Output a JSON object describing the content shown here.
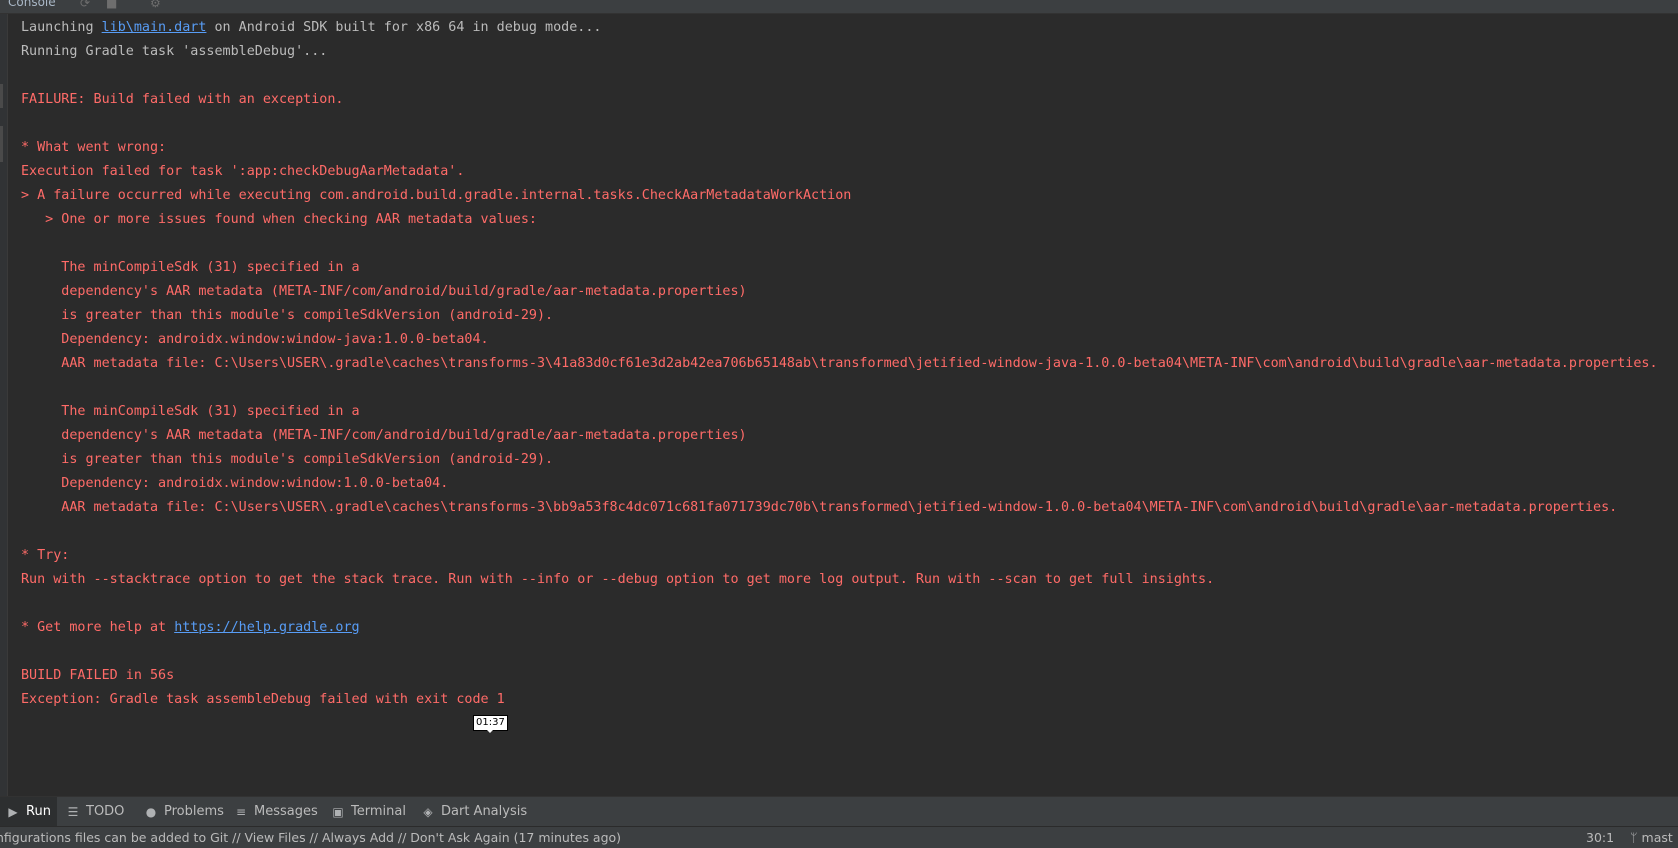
{
  "top_tab": {
    "label": "Console"
  },
  "console_lines": [
    {
      "segments": [
        {
          "text": "Launching ",
          "style": "normal"
        },
        {
          "text": "lib\\main.dart",
          "style": "link"
        },
        {
          "text": " on Android SDK built for x86 64 in debug mode...",
          "style": "normal"
        }
      ]
    },
    {
      "segments": [
        {
          "text": "Running Gradle task 'assembleDebug'...",
          "style": "normal"
        }
      ]
    },
    {
      "segments": []
    },
    {
      "segments": [
        {
          "text": "FAILURE: Build failed with an exception.",
          "style": "error"
        }
      ]
    },
    {
      "segments": []
    },
    {
      "segments": [
        {
          "text": "* What went wrong:",
          "style": "error"
        }
      ]
    },
    {
      "segments": [
        {
          "text": "Execution failed for task ':app:checkDebugAarMetadata'.",
          "style": "error"
        }
      ]
    },
    {
      "segments": [
        {
          "text": "> A failure occurred while executing com.android.build.gradle.internal.tasks.CheckAarMetadataWorkAction",
          "style": "error"
        }
      ]
    },
    {
      "segments": [
        {
          "text": "   > One or more issues found when checking AAR metadata values:",
          "style": "error"
        }
      ]
    },
    {
      "segments": []
    },
    {
      "segments": [
        {
          "text": "     The minCompileSdk (31) specified in a",
          "style": "error"
        }
      ]
    },
    {
      "segments": [
        {
          "text": "     dependency's AAR metadata (META-INF/com/android/build/gradle/aar-metadata.properties)",
          "style": "error"
        }
      ]
    },
    {
      "segments": [
        {
          "text": "     is greater than this module's compileSdkVersion (android-29).",
          "style": "error"
        }
      ]
    },
    {
      "segments": [
        {
          "text": "     Dependency: androidx.window:window-java:1.0.0-beta04.",
          "style": "error"
        }
      ]
    },
    {
      "segments": [
        {
          "text": "     AAR metadata file: C:\\Users\\USER\\.gradle\\caches\\transforms-3\\41a83d0cf61e3d2ab42ea706b65148ab\\transformed\\jetified-window-java-1.0.0-beta04\\META-INF\\com\\android\\build\\gradle\\aar-metadata.properties.",
          "style": "error"
        }
      ]
    },
    {
      "segments": []
    },
    {
      "segments": [
        {
          "text": "     The minCompileSdk (31) specified in a",
          "style": "error"
        }
      ]
    },
    {
      "segments": [
        {
          "text": "     dependency's AAR metadata (META-INF/com/android/build/gradle/aar-metadata.properties)",
          "style": "error"
        }
      ]
    },
    {
      "segments": [
        {
          "text": "     is greater than this module's compileSdkVersion (android-29).",
          "style": "error"
        }
      ]
    },
    {
      "segments": [
        {
          "text": "     Dependency: androidx.window:window:1.0.0-beta04.",
          "style": "error"
        }
      ]
    },
    {
      "segments": [
        {
          "text": "     AAR metadata file: C:\\Users\\USER\\.gradle\\caches\\transforms-3\\bb9a53f8c4dc071c681fa071739dc70b\\transformed\\jetified-window-1.0.0-beta04\\META-INF\\com\\android\\build\\gradle\\aar-metadata.properties.",
          "style": "error"
        }
      ]
    },
    {
      "segments": []
    },
    {
      "segments": [
        {
          "text": "* Try:",
          "style": "error"
        }
      ]
    },
    {
      "segments": [
        {
          "text": "Run with --stacktrace option to get the stack trace. Run with --info or --debug option to get more log output. Run with --scan to get full insights.",
          "style": "error"
        }
      ]
    },
    {
      "segments": []
    },
    {
      "segments": [
        {
          "text": "* Get more help at ",
          "style": "error"
        },
        {
          "text": "https://help.gradle.org",
          "style": "link"
        }
      ]
    },
    {
      "segments": []
    },
    {
      "segments": [
        {
          "text": "BUILD FAILED in 56s",
          "style": "error"
        }
      ]
    },
    {
      "segments": [
        {
          "text": "Exception: Gradle task assembleDebug failed with exit code 1",
          "style": "error"
        }
      ]
    }
  ],
  "tooltip": {
    "text": "01:37"
  },
  "tool_tabs": [
    {
      "label": "Run",
      "icon": "run-icon",
      "glyph": "▶",
      "active": true
    },
    {
      "label": "TODO",
      "icon": "list-icon",
      "glyph": "☰",
      "active": false
    },
    {
      "label": "Problems",
      "icon": "problems-icon",
      "glyph": "●",
      "active": false
    },
    {
      "label": "Messages",
      "icon": "messages-icon",
      "glyph": "≡",
      "active": false
    },
    {
      "label": "Terminal",
      "icon": "terminal-icon",
      "glyph": "▣",
      "active": false
    },
    {
      "label": "Dart Analysis",
      "icon": "dart-icon",
      "glyph": "◈",
      "active": false
    }
  ],
  "status": {
    "message": "nfigurations files can be added to Git // View Files // Always Add // Don't Ask Again (17 minutes ago)",
    "position": "30:1",
    "branch": "mast"
  }
}
